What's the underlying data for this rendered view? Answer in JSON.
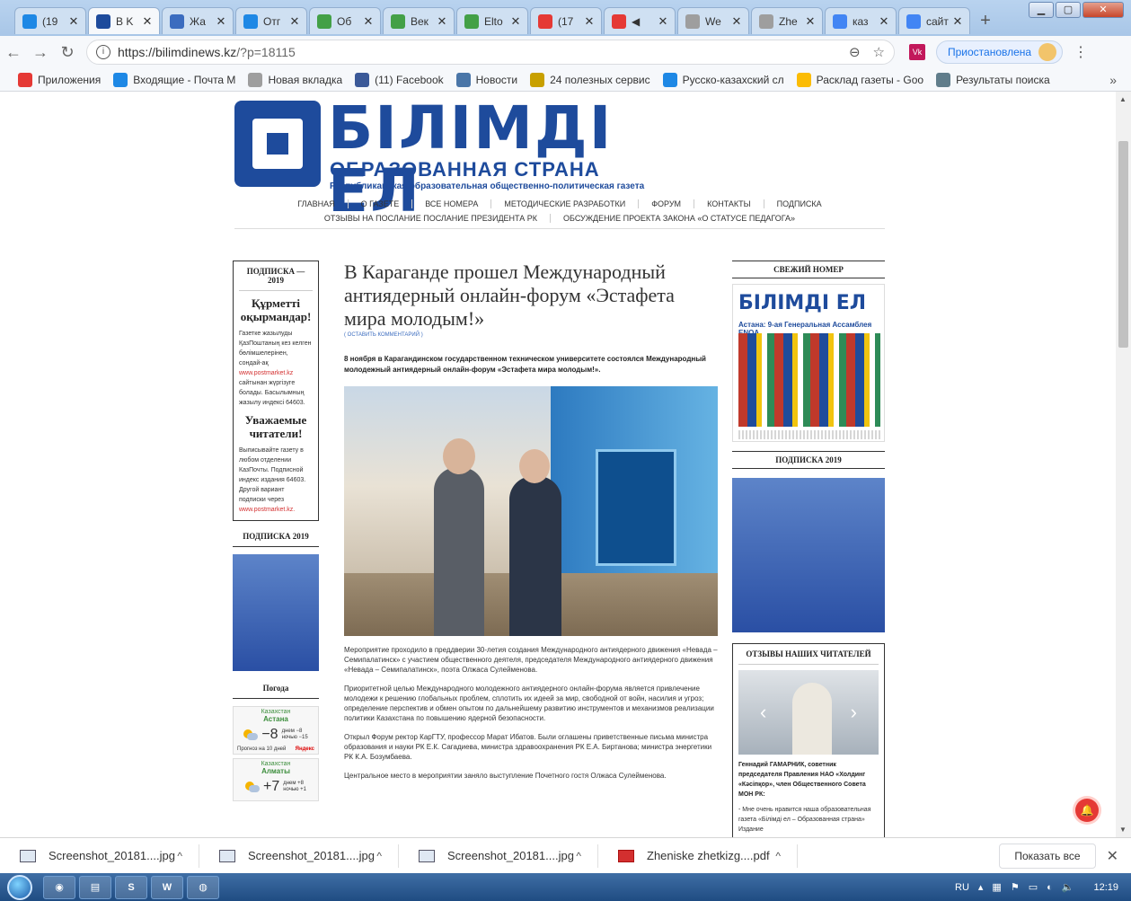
{
  "browser": {
    "tabs": [
      {
        "label": "(19",
        "favicon_color": "#1e88e5",
        "active": false
      },
      {
        "label": "B K",
        "favicon_color": "#1e4b9c",
        "active": true
      },
      {
        "label": "Жа",
        "favicon_color": "#3b6cbf",
        "active": false
      },
      {
        "label": "Отг",
        "favicon_color": "#1e88e5",
        "active": false
      },
      {
        "label": "Об",
        "favicon_color": "#43a047",
        "active": false
      },
      {
        "label": "Век",
        "favicon_color": "#43a047",
        "active": false
      },
      {
        "label": "Elto",
        "favicon_color": "#43a047",
        "active": false
      },
      {
        "label": "(17",
        "favicon_color": "#e53935",
        "active": false
      },
      {
        "label": "◀︎",
        "favicon_color": "#e53935",
        "active": false
      },
      {
        "label": "We",
        "favicon_color": "#9e9e9e",
        "active": false
      },
      {
        "label": "Zhe",
        "favicon_color": "#9e9e9e",
        "active": false
      },
      {
        "label": "каз",
        "favicon_color": "#4285f4",
        "active": false
      },
      {
        "label": "сайт ну",
        "favicon_color": "#4285f4",
        "active": false
      }
    ],
    "url_host": "https://bilimdinews.kz",
    "url_path": "/?p=18115",
    "paused_label": "Приостановлена",
    "bookmarks": [
      {
        "label": "Приложения",
        "color": "#e53935"
      },
      {
        "label": "Входящие - Почта М",
        "color": "#1e88e5"
      },
      {
        "label": "Новая вкладка",
        "color": "#9e9e9e"
      },
      {
        "label": "(11) Facebook",
        "color": "#3b5998"
      },
      {
        "label": "Новости",
        "color": "#4a76a8"
      },
      {
        "label": "24 полезных сервис",
        "color": "#c8a000"
      },
      {
        "label": "Русско-казахский сл",
        "color": "#1e88e5"
      },
      {
        "label": "Расклад газеты - Goo",
        "color": "#fbbc05"
      },
      {
        "label": "Результаты поиска",
        "color": "#607d8b"
      }
    ]
  },
  "site": {
    "logo_title": "БІЛІМДІ ЕЛ",
    "logo_sub": "ОБРАЗОВАННАЯ СТРАНА",
    "logo_tag": "Республиканская образовательная общественно-политическая газета",
    "nav_row1": [
      "ГЛАВНАЯ",
      "О ГАЗЕТЕ",
      "ВСЕ НОМЕРА",
      "МЕТОДИЧЕСКИЕ РАЗРАБОТКИ",
      "ФОРУМ",
      "КОНТАКТЫ",
      "ПОДПИСКА"
    ],
    "nav_row2": [
      "ОТЗЫВЫ НА ПОСЛАНИЕ ПОСЛАНИЕ ПРЕЗИДЕНТА РК",
      "ОБСУЖДЕНИЕ ПРОЕКТА ЗАКОНА «О СТАТУСЕ ПЕДАГОГА»"
    ]
  },
  "left": {
    "sub_title": "ПОДПИСКА — 2019",
    "kz_head": "Құрметті оқырмандар!",
    "kz_text": "Газетке жазылуды ҚазПоштаның кез келген бөлімшелерінен, сондай-ақ",
    "kz_link": "www.postmarket.kz",
    "kz_text2": "сайтынан жүргізуге болады. Басылымның жазылу индексі 64603.",
    "ru_head": "Уважаемые читатели!",
    "ru_text": "Выписывайте газету в любом отделении КазПочты. Подписной индекс издания 64603. Другой вариант подписки через",
    "ru_link": "www.postmarket.kz.",
    "sub2_title": "ПОДПИСКА 2019",
    "weather_title": "Погода",
    "weather": [
      {
        "country": "Казахстан",
        "city": "Астана",
        "temp": "−8",
        "day": "днем −8",
        "night": "ночью −15"
      },
      {
        "country": "Казахстан",
        "city": "Алматы",
        "temp": "+7",
        "day": "днем +8",
        "night": "ночью +1"
      }
    ],
    "weather_link": "Прогноз на 10 дней",
    "weather_brand": "Яндекс"
  },
  "article": {
    "headline": "В Караганде прошел Международный антиядерный онлайн-форум «Эстафета мира молодым!»",
    "comment_link": "( ОСТАВИТЬ КОММЕНТАРИЙ )",
    "lead": "8 ноября в Карагандинском государственном техническом университете состоялся Международный молодежный антиядерный онлайн-форум «Эстафета мира молодым!».",
    "paragraphs": [
      "Мероприятие проходило в преддверии 30-летия создания Международного антиядерного движения «Невада – Семипалатинск» с участием общественного деятеля, председателя Международного антиядерного движения «Невада – Семипалатинск», поэта Олжаса Сулейменова.",
      "Приоритетной целью Международного молодежного антиядерного онлайн-форума является привлечение молодежи к решению глобальных проблем, сплотить их идеей за мир, свободной от войн, насилия и угроз; определение перспектив и обмен опытом по дальнейшему развитию инструментов и механизмов реализации политики Казахстана по повышению ядерной безопасности.",
      "Открыл Форум ректор КарГТУ, профессор Марат Ибатов. Были оглашены приветственные письма министра образования и науки РК Е.К. Сагадиева, министра здравоохранения РК Е.А. Биртанова; министра энергетики РК К.А. Бозумбаева.",
      "Центральное место в мероприятии заняло выступление Почетного гостя Олжаса Сулейменова."
    ]
  },
  "right": {
    "fresh_title": "СВЕЖИЙ НОМЕР",
    "issue_logo": "БІЛІМДІ ЕЛ",
    "issue_headline": "Астана: 9-ая Генеральная Ассамблея ENQA",
    "sub_title": "ПОДПИСКА 2019",
    "reviews_title": "ОТЗЫВЫ НАШИХ ЧИТАТЕЛЕЙ",
    "review_name": "Геннадий ГАМАРНИК, советник председателя Правления НАО «Холдинг «Кәсіпқор», член Общественного Совета МОН РК:",
    "review_quote": "- Мне очень нравится наша образовательная газета «Білімді ел – Образованная страна» Издание"
  },
  "downloads": {
    "items": [
      {
        "name": "Screenshot_20181....jpg",
        "type": "image"
      },
      {
        "name": "Screenshot_20181....jpg",
        "type": "image"
      },
      {
        "name": "Screenshot_20181....jpg",
        "type": "image"
      },
      {
        "name": "Zheniske zhetkizg....pdf",
        "type": "pdf"
      }
    ],
    "show_all": "Показать все"
  },
  "taskbar": {
    "lang": "RU",
    "time": "12:19"
  }
}
